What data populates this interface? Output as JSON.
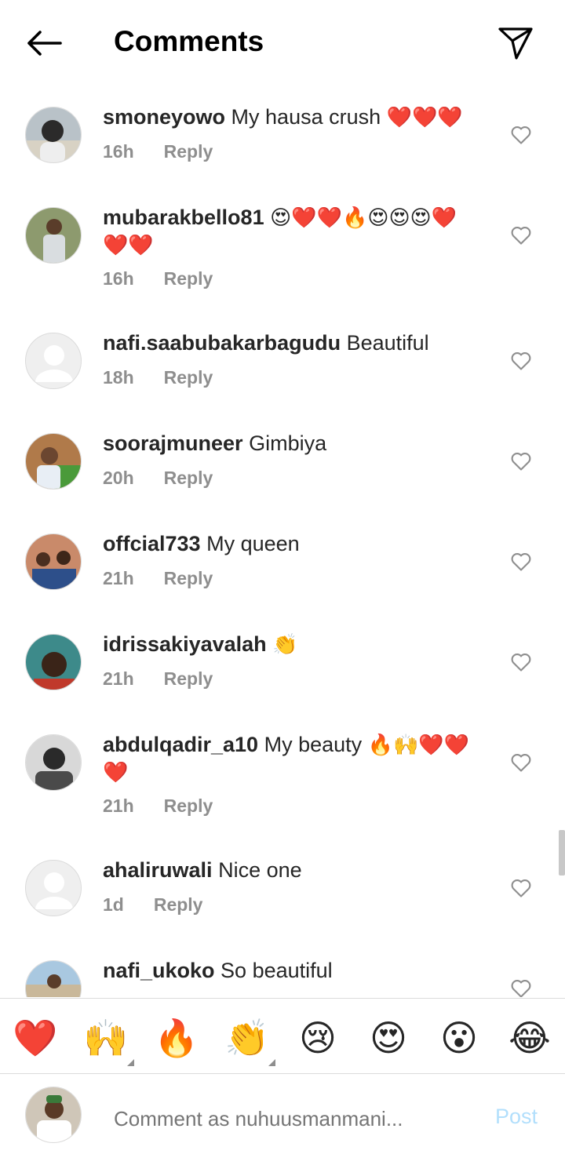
{
  "header": {
    "title": "Comments",
    "back_icon": "back-arrow-icon",
    "share_icon": "send-icon"
  },
  "comments": [
    {
      "username": "smoneyowo",
      "text": "My hausa crush",
      "emoji": "❤️❤️❤️",
      "emoji2": "",
      "time": "16h",
      "reply": "Reply",
      "avatar": "photo"
    },
    {
      "username": "mubarakbello81",
      "text": "",
      "emoji": "😍❤️❤️🔥😍😍😍❤️",
      "emoji2": "❤️❤️",
      "time": "16h",
      "reply": "Reply",
      "avatar": "photo"
    },
    {
      "username": "nafi.saabubakarbagudu",
      "text": "Beautiful",
      "emoji": "",
      "emoji2": "",
      "time": "18h",
      "reply": "Reply",
      "avatar": "placeholder"
    },
    {
      "username": "soorajmuneer",
      "text": "Gimbiya",
      "emoji": "",
      "emoji2": "",
      "time": "20h",
      "reply": "Reply",
      "avatar": "photo"
    },
    {
      "username": "offcial733",
      "text": "My queen",
      "emoji": "",
      "emoji2": "",
      "time": "21h",
      "reply": "Reply",
      "avatar": "photo"
    },
    {
      "username": "idrissakiyavalah",
      "text": "",
      "emoji": "👏",
      "emoji2": "",
      "time": "21h",
      "reply": "Reply",
      "avatar": "photo"
    },
    {
      "username": "abdulqadir_a10",
      "text": "My beauty",
      "emoji": "🔥🙌❤️❤️",
      "emoji2": "❤️",
      "time": "21h",
      "reply": "Reply",
      "avatar": "photo"
    },
    {
      "username": "ahaliruwali",
      "text": "Nice one",
      "emoji": "",
      "emoji2": "",
      "time": "1d",
      "reply": "Reply",
      "avatar": "placeholder"
    },
    {
      "username": "nafi_ukoko",
      "text": "So beautiful",
      "emoji": "",
      "emoji2": "",
      "time": "",
      "reply": "",
      "avatar": "photo"
    }
  ],
  "reactions": [
    "❤️",
    "🙌",
    "🔥",
    "👏",
    "😢",
    "😍",
    "😮",
    "😂"
  ],
  "composer": {
    "placeholder": "Comment as nuhuusmanmani...",
    "post_label": "Post"
  },
  "colors": {
    "text": "#262626",
    "meta": "#8e8e8e",
    "post_disabled": "#b2dffc",
    "divider": "#dbdbdb"
  }
}
